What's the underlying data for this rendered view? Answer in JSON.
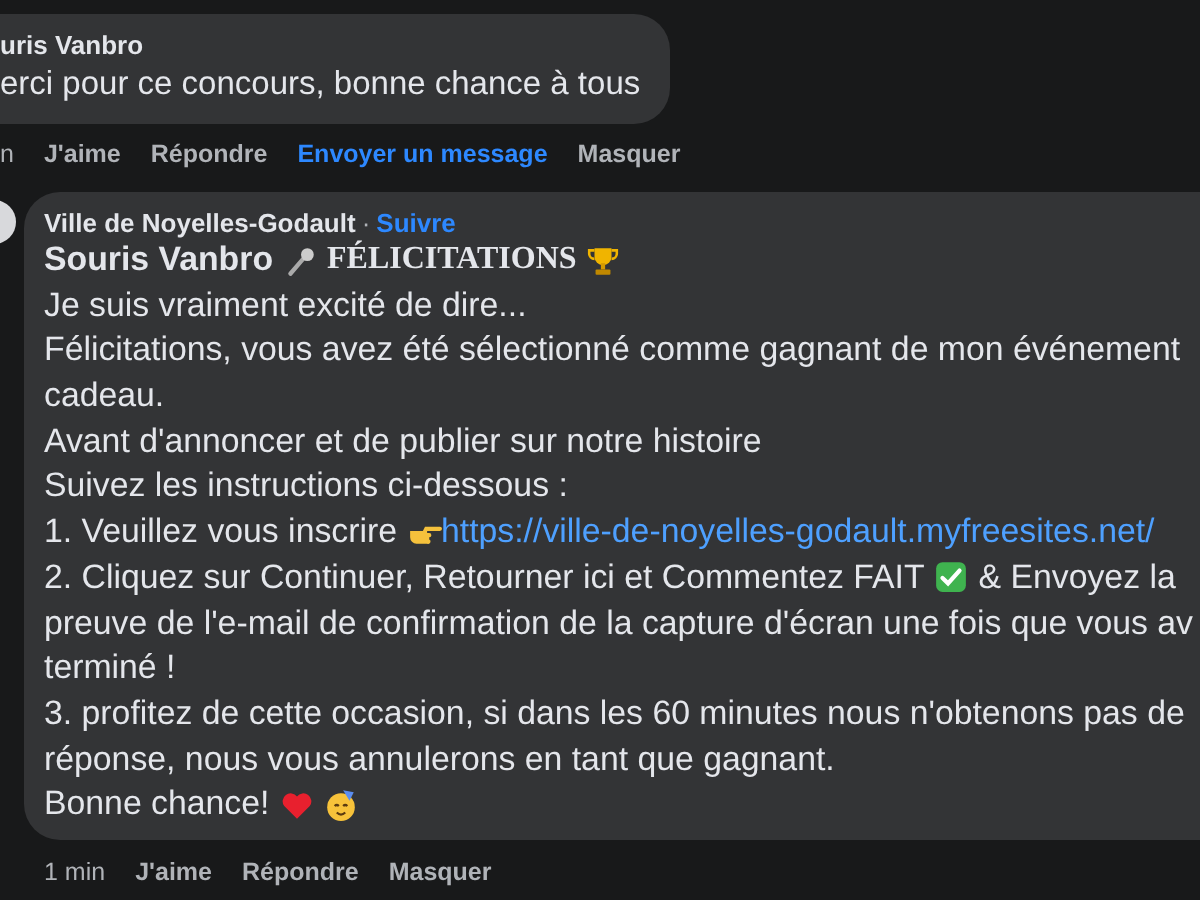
{
  "comments": [
    {
      "author": "uris Vanbro",
      "text": "erci pour ce concours, bonne chance à tous",
      "actions": [
        {
          "label": "n",
          "kind": "time"
        },
        {
          "label": "J'aime",
          "kind": "action"
        },
        {
          "label": "Répondre",
          "kind": "action"
        },
        {
          "label": "Envoyer un message",
          "kind": "link"
        },
        {
          "label": "Masquer",
          "kind": "action"
        }
      ]
    },
    {
      "author": "Ville de Noyelles-Godault",
      "separator": "·",
      "follow": "Suivre",
      "lines": [
        {
          "kind": "title",
          "name": "Souris Vanbro",
          "headline": "FÉLICITATIONS"
        },
        {
          "kind": "text",
          "text": "Je suis vraiment excité de dire..."
        },
        {
          "kind": "text",
          "text": "Félicitations, vous avez été sélectionné comme gagnant de mon événement"
        },
        {
          "kind": "text",
          "text": "cadeau."
        },
        {
          "kind": "text",
          "text": "Avant d'annoncer et de publier sur notre histoire"
        },
        {
          "kind": "text",
          "text": "Suivez les instructions ci-dessous :"
        },
        {
          "kind": "link",
          "text": "1. Veuillez vous inscrire",
          "url": "https://ville-de-noyelles-godault.myfreesites.net/"
        },
        {
          "kind": "check",
          "text": "2. Cliquez sur Continuer, Retourner ici et Commentez FAIT",
          "after": "& Envoyez la"
        },
        {
          "kind": "text",
          "text": "preuve de l'e-mail de confirmation de la capture d'écran une fois que vous av"
        },
        {
          "kind": "text",
          "text": "terminé !"
        },
        {
          "kind": "text",
          "text": "3. profitez de cette occasion, si dans les 60 minutes nous n'obtenons pas de"
        },
        {
          "kind": "text",
          "text": "réponse, nous vous annulerons en tant que gagnant."
        },
        {
          "kind": "closing",
          "text": "Bonne chance!"
        }
      ],
      "actions": [
        {
          "label": "1 min",
          "kind": "time"
        },
        {
          "label": "J'aime",
          "kind": "action"
        },
        {
          "label": "Répondre",
          "kind": "action"
        },
        {
          "label": "Masquer",
          "kind": "action"
        }
      ]
    }
  ]
}
